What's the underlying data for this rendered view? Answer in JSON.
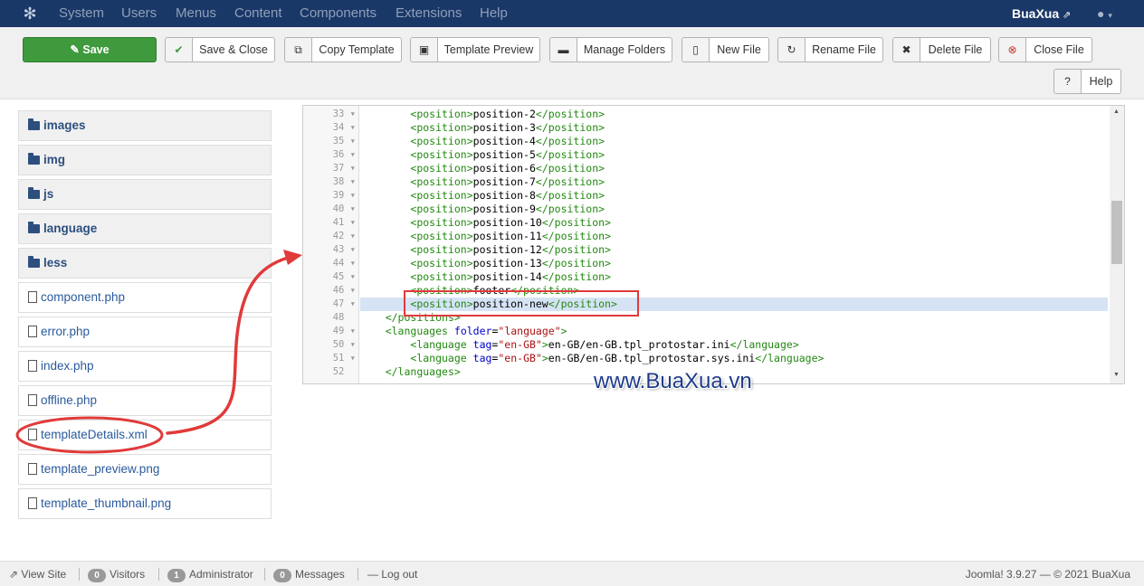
{
  "topnav": {
    "items": [
      "System",
      "Users",
      "Menus",
      "Content",
      "Components",
      "Extensions",
      "Help"
    ],
    "site_name": "BuaXua",
    "site_icon": "external-link-icon",
    "user_icon": "user-icon"
  },
  "toolbar": {
    "save": "Save",
    "save_close": "Save & Close",
    "copy_template": "Copy Template",
    "template_preview": "Template Preview",
    "manage_folders": "Manage Folders",
    "new_file": "New File",
    "rename_file": "Rename File",
    "delete_file": "Delete File",
    "close_file": "Close File",
    "help": "Help"
  },
  "tree": {
    "folders": [
      "images",
      "img",
      "js",
      "language",
      "less"
    ],
    "files": [
      "component.php",
      "error.php",
      "index.php",
      "offline.php",
      "templateDetails.xml",
      "template_preview.png",
      "template_thumbnail.png"
    ],
    "selected_file": "templateDetails.xml"
  },
  "editor": {
    "line_numbers": [
      "33",
      "34",
      "35",
      "36",
      "37",
      "38",
      "39",
      "40",
      "41",
      "42",
      "43",
      "44",
      "45",
      "46",
      "47",
      "48",
      "49",
      "50",
      "51",
      "52"
    ],
    "positions": [
      "position-2",
      "position-3",
      "position-4",
      "position-5",
      "position-6",
      "position-7",
      "position-8",
      "position-9",
      "position-10",
      "position-11",
      "position-12",
      "position-13",
      "position-14",
      "footer",
      "position-new"
    ],
    "active_line": "47",
    "languages_folder": "language",
    "lang_tag": "en-GB",
    "lang_files": [
      "en-GB/en-GB.tpl_protostar.ini",
      "en-GB/en-GB.tpl_protostar.sys.ini"
    ]
  },
  "watermark": "www.BuaXua.vn",
  "footer": {
    "view_site": "View Site",
    "visitors_count": "0",
    "visitors": "Visitors",
    "admin_count": "1",
    "administrator": "Administrator",
    "messages_count": "0",
    "messages": "Messages",
    "logout": "Log out",
    "version": "Joomla! 3.9.27 — © 2021 BuaXua"
  },
  "colors": {
    "topbar": "#1a3867",
    "save_button": "#3e9a3d",
    "annotation": "#e03a3a",
    "active_line": "#d5e3f5"
  }
}
